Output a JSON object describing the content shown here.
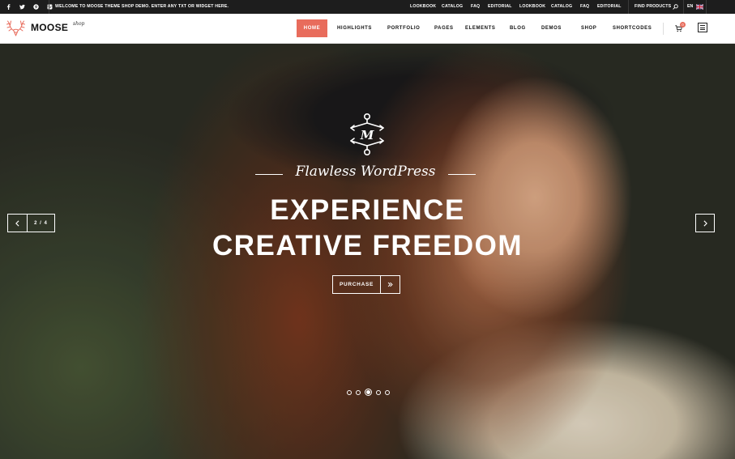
{
  "topbar": {
    "social_icons": [
      "facebook-icon",
      "twitter-icon",
      "pinterest-icon",
      "instagram-icon"
    ],
    "welcome": "WELCOME TO MOOSE THEME SHOP DEMO. ENTER ANY TXT OR WIDGET HERE.",
    "links": [
      "LOOKBOOK",
      "CATALOG",
      "FAQ",
      "EDITORIAL",
      "LOOKBOOK",
      "CATALOG",
      "FAQ",
      "EDITORIAL"
    ],
    "find": "FIND PRODUCTS",
    "lang": "EN"
  },
  "header": {
    "logo": "MOOSE",
    "logo_sub": "shop",
    "nav": [
      "HOME",
      "HIGHLIGHTS",
      "PORTFOLIO",
      "PAGES",
      "ELEMENTS",
      "BLOG",
      "DEMOS",
      "SHOP",
      "SHORTCODES"
    ],
    "cart_count": "0",
    "accent": "#e86c5c"
  },
  "hero": {
    "emblem_letter": "M",
    "tagline": "Flawless WordPress",
    "headline_1": "EXPERIENCE",
    "headline_2": "CREATIVE FREEDOM",
    "button": "PURCHASE",
    "slide_counter": "2 / 4",
    "dots": 5,
    "active_dot": 3
  }
}
